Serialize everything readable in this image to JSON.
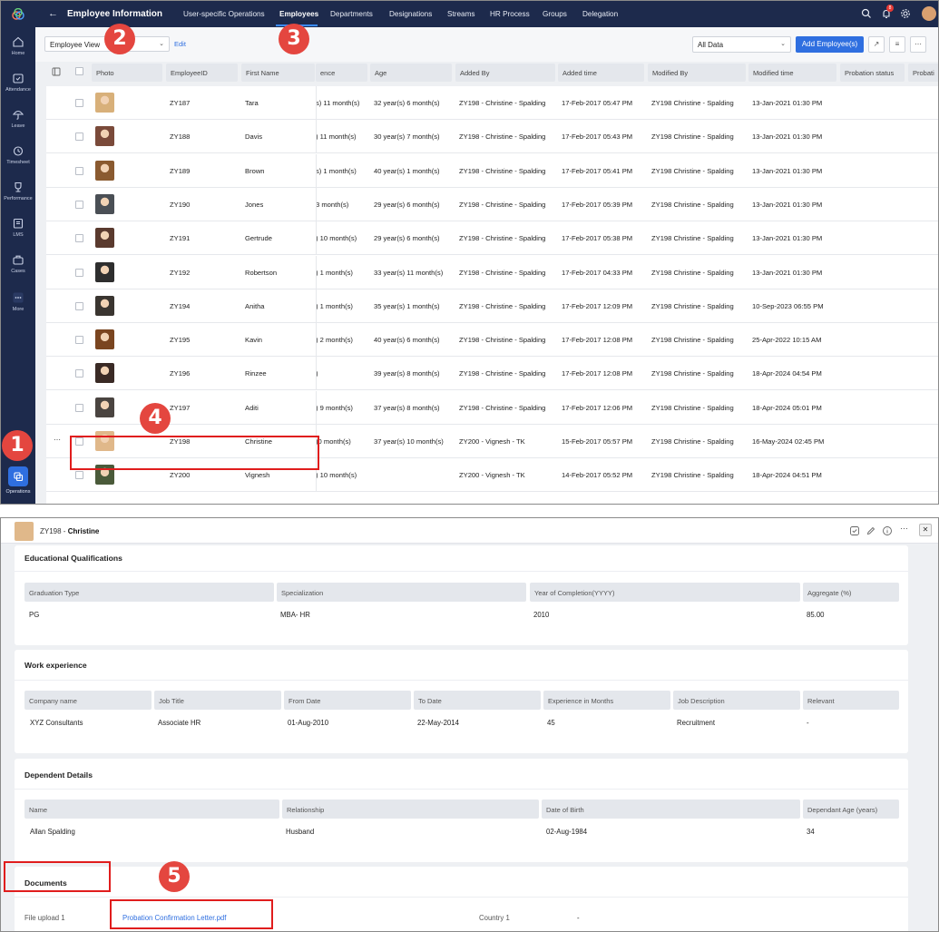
{
  "sidebar": {
    "items": [
      {
        "label": "Home",
        "icon": "home-icon"
      },
      {
        "label": "Attendance",
        "icon": "calendar-icon"
      },
      {
        "label": "Leave",
        "icon": "umbrella-icon"
      },
      {
        "label": "Timesheet",
        "icon": "clock-icon"
      },
      {
        "label": "Performance",
        "icon": "trophy-icon"
      },
      {
        "label": "LMS",
        "icon": "book-icon"
      },
      {
        "label": "Cases",
        "icon": "briefcase-icon"
      },
      {
        "label": "More",
        "icon": "dots-icon"
      }
    ],
    "active_label": "Operations"
  },
  "topbar": {
    "title": "Employee Information",
    "tabs": [
      "User-specific Operations",
      "Employees",
      "Departments",
      "Designations",
      "Streams",
      "HR Process",
      "Groups",
      "Delegation"
    ],
    "active_tab": "Employees",
    "notification_count": "8"
  },
  "toolbar": {
    "view": "Employee View",
    "edit": "Edit",
    "filter": "All Data",
    "add_button": "Add Employee(s)"
  },
  "grid": {
    "columns": [
      "Photo",
      "EmployeeID",
      "First Name",
      "ence",
      "Age",
      "Added By",
      "Added time",
      "Modified By",
      "Modified time",
      "Probation status",
      "Probati"
    ],
    "rows": [
      {
        "id": "ZY187",
        "first": "Tara",
        "exp": "s) 11 month(s)",
        "age": "32 year(s) 6 month(s)",
        "added_by": "ZY198 - Christine - Spalding",
        "added_time": "17-Feb-2017 05:47 PM",
        "modified_by": "ZY198 Christine - Spalding",
        "modified_time": "13-Jan-2021 01:30 PM",
        "photo_color": "#d8b07a"
      },
      {
        "id": "ZY188",
        "first": "Davis",
        "exp": ") 11 month(s)",
        "age": "30 year(s) 7 month(s)",
        "added_by": "ZY198 - Christine - Spalding",
        "added_time": "17-Feb-2017 05:43 PM",
        "modified_by": "ZY198 Christine - Spalding",
        "modified_time": "13-Jan-2021 01:30 PM",
        "photo_color": "#7a4a3a"
      },
      {
        "id": "ZY189",
        "first": "Brown",
        "exp": "s) 1 month(s)",
        "age": "40 year(s) 1 month(s)",
        "added_by": "ZY198 - Christine - Spalding",
        "added_time": "17-Feb-2017 05:41 PM",
        "modified_by": "ZY198 Christine - Spalding",
        "modified_time": "13-Jan-2021 01:30 PM",
        "photo_color": "#8a5a30"
      },
      {
        "id": "ZY190",
        "first": "Jones",
        "exp": "3 month(s)",
        "age": "29 year(s) 6 month(s)",
        "added_by": "ZY198 - Christine - Spalding",
        "added_time": "17-Feb-2017 05:39 PM",
        "modified_by": "ZY198 Christine - Spalding",
        "modified_time": "13-Jan-2021 01:30 PM",
        "photo_color": "#4a4f55"
      },
      {
        "id": "ZY191",
        "first": "Gertrude",
        "exp": ") 10 month(s)",
        "age": "29 year(s) 6 month(s)",
        "added_by": "ZY198 - Christine - Spalding",
        "added_time": "17-Feb-2017 05:38 PM",
        "modified_by": "ZY198 Christine - Spalding",
        "modified_time": "13-Jan-2021 01:30 PM",
        "photo_color": "#5a3a2e"
      },
      {
        "id": "ZY192",
        "first": "Robertson",
        "exp": ") 1 month(s)",
        "age": "33 year(s) 11 month(s)",
        "added_by": "ZY198 - Christine - Spalding",
        "added_time": "17-Feb-2017 04:33 PM",
        "modified_by": "ZY198 Christine - Spalding",
        "modified_time": "13-Jan-2021 01:30 PM",
        "photo_color": "#2e2e2e"
      },
      {
        "id": "ZY194",
        "first": "Anitha",
        "exp": ") 1 month(s)",
        "age": "35 year(s) 1 month(s)",
        "added_by": "ZY198 - Christine - Spalding",
        "added_time": "17-Feb-2017 12:09 PM",
        "modified_by": "ZY198 Christine - Spalding",
        "modified_time": "10-Sep-2023 06:55 PM",
        "photo_color": "#3a3530"
      },
      {
        "id": "ZY195",
        "first": "Kavin",
        "exp": ") 2 month(s)",
        "age": "40 year(s) 6 month(s)",
        "added_by": "ZY198 - Christine - Spalding",
        "added_time": "17-Feb-2017 12:08 PM",
        "modified_by": "ZY198 Christine - Spalding",
        "modified_time": "25-Apr-2022 10:15 AM",
        "photo_color": "#7a4520"
      },
      {
        "id": "ZY196",
        "first": "Rinzee",
        "exp": ")",
        "age": "39 year(s) 8 month(s)",
        "added_by": "ZY198 - Christine - Spalding",
        "added_time": "17-Feb-2017 12:08 PM",
        "modified_by": "ZY198 Christine - Spalding",
        "modified_time": "18-Apr-2024 04:54 PM",
        "photo_color": "#3a2a25"
      },
      {
        "id": "ZY197",
        "first": "Aditi",
        "exp": ") 9 month(s)",
        "age": "37 year(s) 8 month(s)",
        "added_by": "ZY198 - Christine - Spalding",
        "added_time": "17-Feb-2017 12:06 PM",
        "modified_by": "ZY198 Christine - Spalding",
        "modified_time": "18-Apr-2024 05:01 PM",
        "photo_color": "#4a4440"
      },
      {
        "id": "ZY198",
        "first": "Christine",
        "exp": ")0 month(s)",
        "age": "37 year(s) 10 month(s)",
        "added_by": "ZY200 - Vignesh - TK",
        "added_time": "15-Feb-2017 05:57 PM",
        "modified_by": "ZY198 Christine - Spalding",
        "modified_time": "16-May-2024 02:45 PM",
        "photo_color": "#e0b88a"
      },
      {
        "id": "ZY200",
        "first": "Vignesh",
        "exp": ") 10 month(s)",
        "age": "",
        "added_by": "ZY200 - Vignesh - TK",
        "added_time": "14-Feb-2017 05:52 PM",
        "modified_by": "ZY198 Christine - Spalding",
        "modified_time": "18-Apr-2024 04:51 PM",
        "photo_color": "#4a5a3a"
      }
    ]
  },
  "markers": [
    "1",
    "2",
    "3",
    "4",
    "5"
  ],
  "detail": {
    "title_id": "ZY198 -",
    "title_name": "Christine",
    "education": {
      "title": "Educational Qualifications",
      "headers": [
        "Graduation Type",
        "Specialization",
        "Year of Completion(YYYY)",
        "Aggregate (%)"
      ],
      "values": [
        "PG",
        "MBA- HR",
        "2010",
        "85.00"
      ]
    },
    "work": {
      "title": "Work experience",
      "headers": [
        "Company name",
        "Job Title",
        "From Date",
        "To Date",
        "Experience in Months",
        "Job Description",
        "Relevant"
      ],
      "values": [
        "XYZ Consultants",
        "Associate HR",
        "01-Aug-2010",
        "22-May-2014",
        "45",
        "Recruitment",
        "-"
      ]
    },
    "dependent": {
      "title": "Dependent Details",
      "headers": [
        "Name",
        "Relationship",
        "Date of Birth",
        "Dependant Age (years)"
      ],
      "values": [
        "Allan Spalding",
        "Husband",
        "02-Aug-1984",
        "34"
      ]
    },
    "documents": {
      "title": "Documents",
      "file_label": "File upload 1",
      "file_name": "Probation Confirmation Letter.pdf",
      "country_label": "Country 1",
      "country_value": "-"
    }
  }
}
